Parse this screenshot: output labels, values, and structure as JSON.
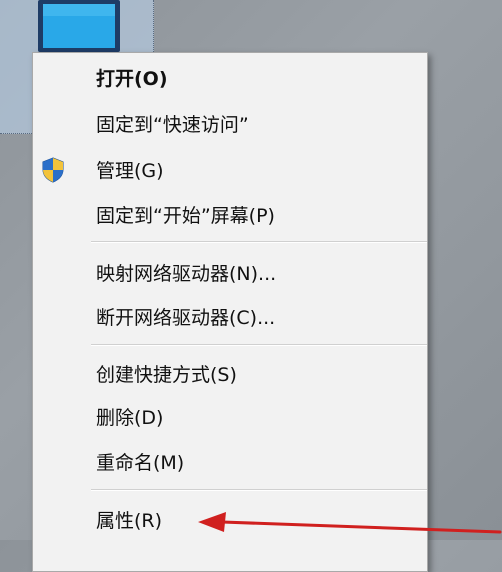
{
  "context_menu": {
    "items": [
      {
        "id": "open",
        "label": "打开(O)",
        "bold": true
      },
      {
        "id": "pin-quick-access",
        "label": "固定到“快速访问”"
      },
      {
        "id": "manage",
        "label": "管理(G)",
        "icon": "uac-shield-icon"
      },
      {
        "id": "pin-start",
        "label": "固定到“开始”屏幕(P)"
      },
      {
        "id": "map-network-drive",
        "label": "映射网络驱动器(N)..."
      },
      {
        "id": "disconnect-network-drive",
        "label": "断开网络驱动器(C)..."
      },
      {
        "id": "create-shortcut",
        "label": "创建快捷方式(S)"
      },
      {
        "id": "delete",
        "label": "删除(D)"
      },
      {
        "id": "rename",
        "label": "重命名(M)"
      },
      {
        "id": "properties",
        "label": "属性(R)"
      }
    ]
  },
  "colors": {
    "menu_background": "#f2f2f2",
    "arrow": "#d0201f",
    "shield_blue": "#2b6fc9",
    "shield_yellow": "#f3c33b"
  }
}
